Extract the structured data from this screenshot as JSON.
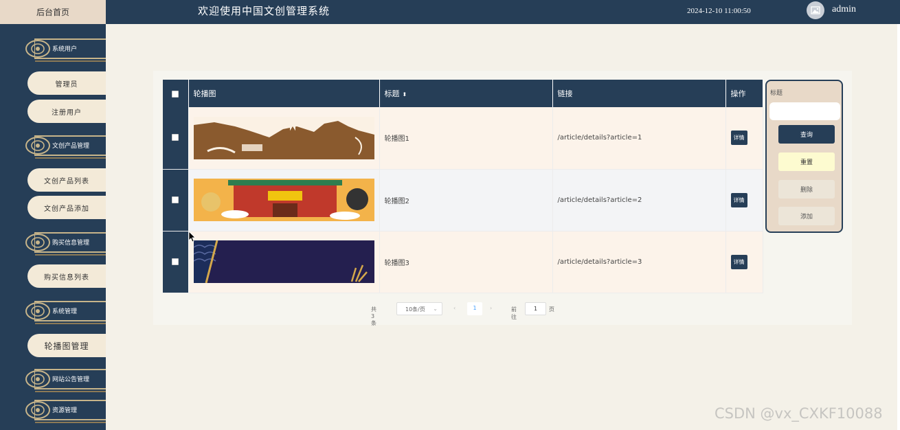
{
  "header": {
    "home_tab": "后台首页",
    "system_title": "欢迎使用中国文创管理系统",
    "datetime": "2024-12-10 11:00:50",
    "username": "admin",
    "avatar_icon": "image-icon"
  },
  "sidebar": {
    "groups": [
      {
        "label": "系统用户"
      },
      {
        "label": "文创产品管理"
      },
      {
        "label": "购买信息管理"
      },
      {
        "label": "系统管理"
      },
      {
        "label": "网站公告管理"
      },
      {
        "label": "资源管理"
      }
    ],
    "items": [
      {
        "label": "管理员"
      },
      {
        "label": "注册用户"
      },
      {
        "label": "文创产品列表"
      },
      {
        "label": "文创产品添加"
      },
      {
        "label": "购买信息列表"
      },
      {
        "label": "轮播图管理"
      }
    ]
  },
  "table": {
    "columns": {
      "image": "轮播图",
      "title": "标题",
      "link": "链接",
      "action": "操作"
    },
    "rows": [
      {
        "title": "轮播图1",
        "link": "/article/details?article=1",
        "action": "详情"
      },
      {
        "title": "轮播图2",
        "link": "/article/details?article=2",
        "action": "详情"
      },
      {
        "title": "轮播图3",
        "link": "/article/details?article=3",
        "action": "详情"
      }
    ]
  },
  "pagination": {
    "total": "共 3 条",
    "page_size": "10条/页",
    "current_page": "1",
    "goto_label": "前往",
    "goto_value": "1",
    "page_unit": "页"
  },
  "search_panel": {
    "label": "标题",
    "query": "查询",
    "reset": "重置",
    "delete": "删除",
    "add": "添加"
  },
  "watermark": "CSDN @vx_CXKF10088",
  "colors": {
    "primary": "#263e57",
    "accent": "#c8b58a",
    "background": "#f4f1e8"
  }
}
